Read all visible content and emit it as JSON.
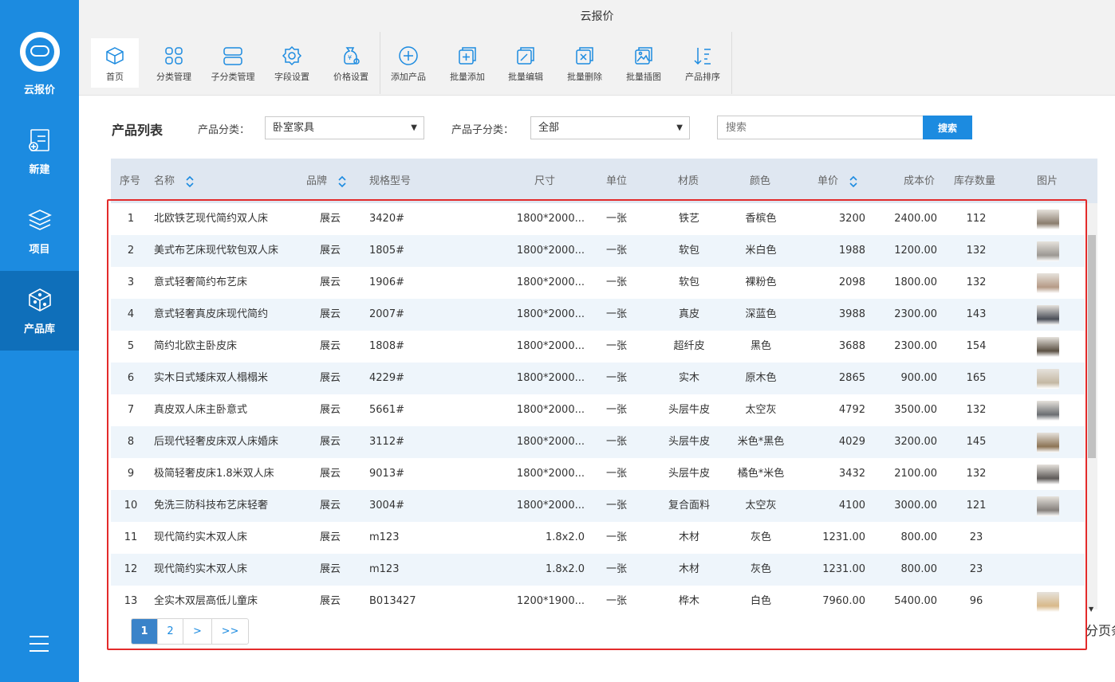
{
  "app": {
    "title": "云报价"
  },
  "sidebar": {
    "logo_label": "云报价",
    "items": [
      {
        "label": "新建",
        "icon": "new-doc-icon"
      },
      {
        "label": "项目",
        "icon": "layers-icon"
      },
      {
        "label": "产品库",
        "icon": "cube-icon"
      }
    ],
    "active": "产品库",
    "menu_icon": "hamburger-icon"
  },
  "toolbar": {
    "buttons": [
      {
        "label": "首页",
        "icon": "box-home-icon"
      },
      {
        "label": "分类管理",
        "icon": "grid-icon"
      },
      {
        "label": "子分类管理",
        "icon": "subcategory-icon"
      },
      {
        "label": "字段设置",
        "icon": "gear-icon"
      },
      {
        "label": "价格设置",
        "icon": "price-settings-icon"
      },
      {
        "label": "添加产品",
        "icon": "plus-circle-icon"
      },
      {
        "label": "批量添加",
        "icon": "batch-add-icon"
      },
      {
        "label": "批量编辑",
        "icon": "batch-edit-icon"
      },
      {
        "label": "批量删除",
        "icon": "batch-delete-icon"
      },
      {
        "label": "批量插图",
        "icon": "batch-image-icon"
      },
      {
        "label": "产品排序",
        "icon": "sort-icon"
      }
    ]
  },
  "filters": {
    "list_title": "产品列表",
    "category_label": "产品分类：",
    "category_value": "卧室家具",
    "subcategory_label": "产品子分类：",
    "subcategory_value": "全部",
    "search_placeholder": "搜索",
    "search_button": "搜索"
  },
  "table": {
    "columns": [
      "序号",
      "名称",
      "品牌",
      "规格型号",
      "尺寸",
      "单位",
      "材质",
      "颜色",
      "单价",
      "成本价",
      "库存数量",
      "图片"
    ],
    "rows": [
      {
        "no": "1",
        "name": "北欧铁艺现代简约双人床",
        "brand": "展云",
        "model": "3420#",
        "size": "1800*2000...",
        "unit": "一张",
        "material": "铁艺",
        "color": "香槟色",
        "price": "3200",
        "cost": "2400.00",
        "stock": "112",
        "thumb": "#8a7d6e"
      },
      {
        "no": "2",
        "name": "美式布艺床现代软包双人床",
        "brand": "展云",
        "model": "1805#",
        "size": "1800*2000...",
        "unit": "一张",
        "material": "软包",
        "color": "米白色",
        "price": "1988",
        "cost": "1200.00",
        "stock": "132",
        "thumb": "#9c9893"
      },
      {
        "no": "3",
        "name": "意式轻奢简约布艺床",
        "brand": "展云",
        "model": "1906#",
        "size": "1800*2000...",
        "unit": "一张",
        "material": "软包",
        "color": "裸粉色",
        "price": "2098",
        "cost": "1800.00",
        "stock": "132",
        "thumb": "#b59a86"
      },
      {
        "no": "4",
        "name": "意式轻奢真皮床现代简约",
        "brand": "展云",
        "model": "2007#",
        "size": "1800*2000...",
        "unit": "一张",
        "material": "真皮",
        "color": "深蓝色",
        "price": "3988",
        "cost": "2300.00",
        "stock": "143",
        "thumb": "#4a4e57"
      },
      {
        "no": "5",
        "name": "简约北欧主卧皮床",
        "brand": "展云",
        "model": "1808#",
        "size": "1800*2000...",
        "unit": "一张",
        "material": "超纤皮",
        "color": "黑色",
        "price": "3688",
        "cost": "2300.00",
        "stock": "154",
        "thumb": "#5b5144"
      },
      {
        "no": "6",
        "name": "实木日式矮床双人榻榻米",
        "brand": "展云",
        "model": "4229#",
        "size": "1800*2000...",
        "unit": "一张",
        "material": "实木",
        "color": "原木色",
        "price": "2865",
        "cost": "900.00",
        "stock": "165",
        "thumb": "#c4b8a3"
      },
      {
        "no": "7",
        "name": "真皮双人床主卧意式",
        "brand": "展云",
        "model": "5661#",
        "size": "1800*2000...",
        "unit": "一张",
        "material": "头层牛皮",
        "color": "太空灰",
        "price": "4792",
        "cost": "3500.00",
        "stock": "132",
        "thumb": "#6b6e72"
      },
      {
        "no": "8",
        "name": "后现代轻奢皮床双人床婚床",
        "brand": "展云",
        "model": "3112#",
        "size": "1800*2000...",
        "unit": "一张",
        "material": "头层牛皮",
        "color": "米色*黑色",
        "price": "4029",
        "cost": "3200.00",
        "stock": "145",
        "thumb": "#8c7355"
      },
      {
        "no": "9",
        "name": "极简轻奢皮床1.8米双人床",
        "brand": "展云",
        "model": "9013#",
        "size": "1800*2000...",
        "unit": "一张",
        "material": "头层牛皮",
        "color": "橘色*米色",
        "price": "3432",
        "cost": "2100.00",
        "stock": "132",
        "thumb": "#5e5a58"
      },
      {
        "no": "10",
        "name": "免洗三防科技布艺床轻奢",
        "brand": "展云",
        "model": "3004#",
        "size": "1800*2000...",
        "unit": "一张",
        "material": "复合面料",
        "color": "太空灰",
        "price": "4100",
        "cost": "3000.00",
        "stock": "121",
        "thumb": "#85807c"
      },
      {
        "no": "11",
        "name": "现代简约实木双人床",
        "brand": "展云",
        "model": "m123",
        "size": "1.8x2.0",
        "unit": "一张",
        "material": "木材",
        "color": "灰色",
        "price": "1231.00",
        "cost": "800.00",
        "stock": "23",
        "thumb": ""
      },
      {
        "no": "12",
        "name": "现代简约实木双人床",
        "brand": "展云",
        "model": "m123",
        "size": "1.8x2.0",
        "unit": "一张",
        "material": "木材",
        "color": "灰色",
        "price": "1231.00",
        "cost": "800.00",
        "stock": "23",
        "thumb": ""
      },
      {
        "no": "13",
        "name": "全实木双层高低儿童床",
        "brand": "展云",
        "model": "B013427",
        "size": "1200*1900...",
        "unit": "一张",
        "material": "桦木",
        "color": "白色",
        "price": "7960.00",
        "cost": "5400.00",
        "stock": "96",
        "thumb": "#d8b98a"
      }
    ]
  },
  "pagination": {
    "pages": [
      "1",
      "2",
      ">",
      ">>"
    ],
    "current": "1",
    "tail_text": "分页条"
  },
  "colors": {
    "sidebar": "#1c8be0",
    "sidebar_active": "#0f6fba",
    "accent": "#1c8be0",
    "header_row": "#dfe7f1",
    "alt_row": "#eef5fb",
    "highlight_border": "#e32b2b"
  }
}
